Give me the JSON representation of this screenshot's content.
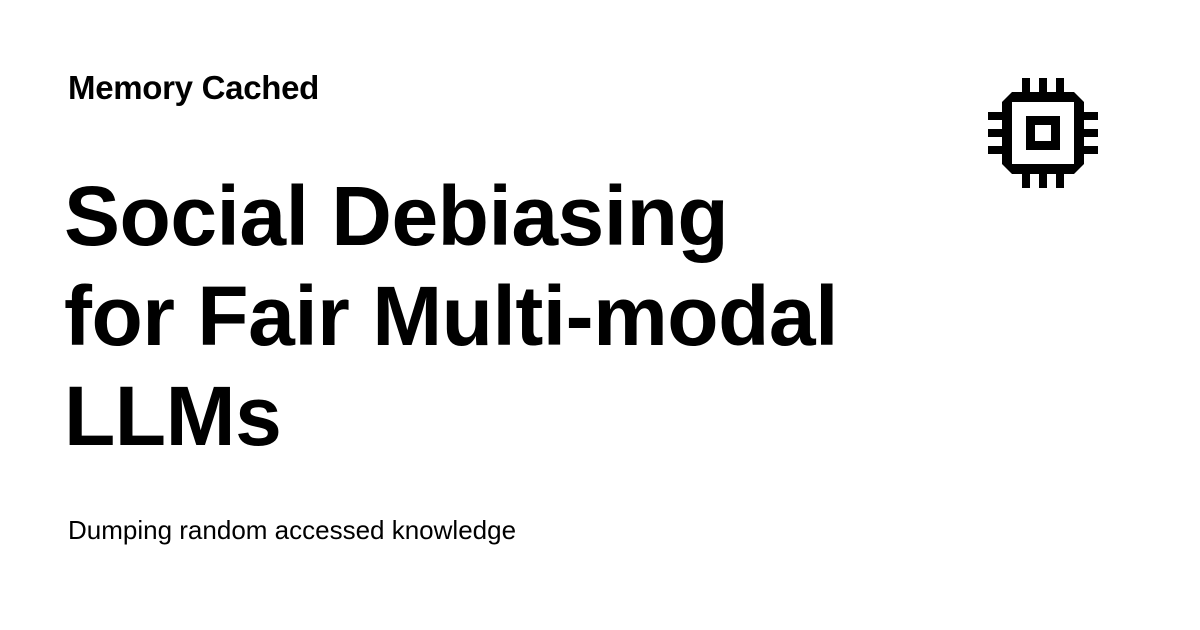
{
  "site": {
    "name": "Memory Cached",
    "tagline": "Dumping random accessed knowledge",
    "logo_icon": "cpu-chip-icon"
  },
  "post": {
    "title_lines": [
      "Social Debiasing",
      "for Fair Multi-modal",
      "LLMs"
    ]
  },
  "colors": {
    "background": "#ffffff",
    "text": "#000000"
  }
}
